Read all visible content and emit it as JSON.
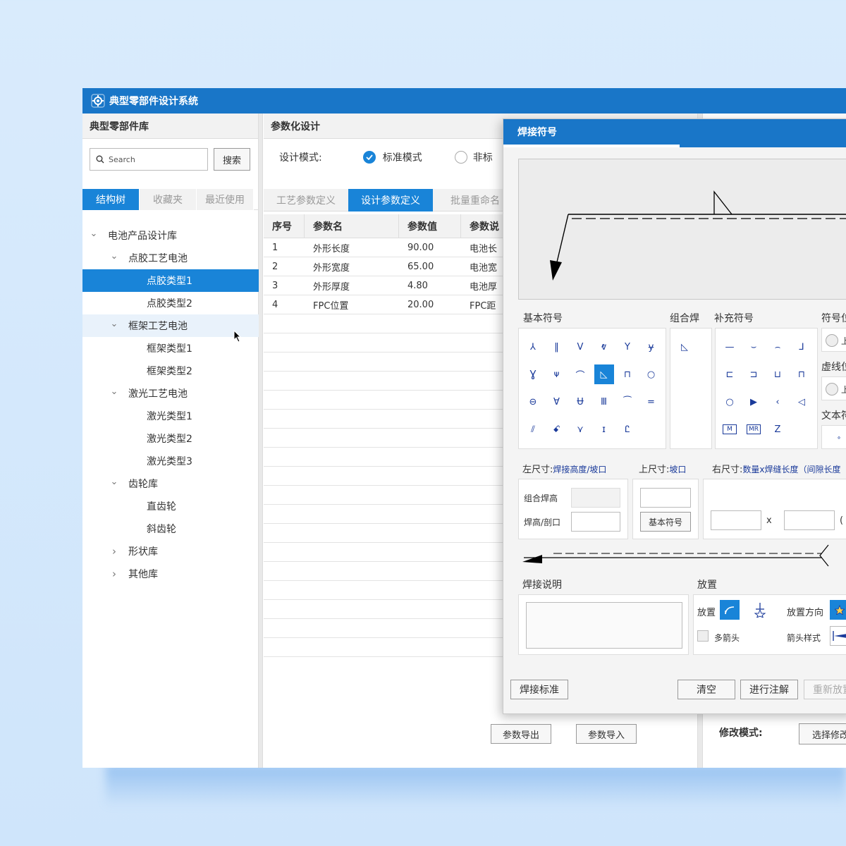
{
  "app": {
    "title": "典型零部件设计系统"
  },
  "left_panel": {
    "header": "典型零部件库",
    "search": {
      "placeholder": "Search",
      "button": "搜索"
    },
    "tabs": [
      "结构树",
      "收藏夹",
      "最近使用"
    ],
    "active_tab": "结构树",
    "tree": [
      {
        "label": "电池产品设计库",
        "level": 0,
        "expanded": true
      },
      {
        "label": "点胶工艺电池",
        "level": 1,
        "expanded": true
      },
      {
        "label": "点胶类型1",
        "level": 2,
        "selected": true
      },
      {
        "label": "点胶类型2",
        "level": 2
      },
      {
        "label": "框架工艺电池",
        "level": 1,
        "expanded": true,
        "hover": true
      },
      {
        "label": "框架类型1",
        "level": 2
      },
      {
        "label": "框架类型2",
        "level": 2
      },
      {
        "label": "激光工艺电池",
        "level": 1,
        "expanded": true
      },
      {
        "label": "激光类型1",
        "level": 2
      },
      {
        "label": "激光类型2",
        "level": 2
      },
      {
        "label": "激光类型3",
        "level": 2
      },
      {
        "label": "齿轮库",
        "level": 1,
        "expanded": true
      },
      {
        "label": "直齿轮",
        "level": 2
      },
      {
        "label": "斜齿轮",
        "level": 2
      },
      {
        "label": "形状库",
        "level": 1,
        "expanded": false
      },
      {
        "label": "其他库",
        "level": 1,
        "expanded": false
      }
    ]
  },
  "middle_panel": {
    "header": "参数化设计",
    "design_mode_label": "设计模式:",
    "mode_options": [
      "标准模式",
      "非标"
    ],
    "selected_mode": "标准模式",
    "tabs": [
      "工艺参数定义",
      "设计参数定义",
      "批量重命名"
    ],
    "active_tab": "设计参数定义",
    "table": {
      "columns": [
        "序号",
        "参数名",
        "参数值",
        "参数说"
      ],
      "rows": [
        [
          "1",
          "外形长度",
          "90.00",
          "电池长"
        ],
        [
          "2",
          "外形宽度",
          "65.00",
          "电池宽"
        ],
        [
          "3",
          "外形厚度",
          "4.80",
          "电池厚"
        ],
        [
          "4",
          "FPC位置",
          "20.00",
          "FPC距"
        ]
      ]
    },
    "export_button": "参数导出",
    "import_button": "参数导入"
  },
  "right_panel": {
    "modify_label": "修改模式:",
    "modify_button": "选择修改"
  },
  "dialog": {
    "title": "焊接符号",
    "basic_symbols_label": "基本符号",
    "combo_label": "组合焊",
    "supplement_label": "补充符号",
    "symbol_pos_label": "符号位",
    "dashed_label": "虚线位",
    "text_label": "文本符",
    "radio_up": "上",
    "left_size_label": "左尺寸:",
    "left_size_value": "焊接高度/坡口",
    "top_size_label": "上尺寸:",
    "top_size_value": "坡口",
    "right_size_label": "右尺寸:",
    "right_size_value": "数量x焊缝长度（间隙长度",
    "combo_height_label": "组合焊高",
    "weld_height_label": "焊高/剖口",
    "basic_symbol_button": "基本符号",
    "times_sign": "x",
    "paren": "(",
    "description_label": "焊接说明",
    "placement_label": "放置",
    "place_label": "放置",
    "place_direction_label": "放置方向",
    "multi_arrow_label": "多箭头",
    "arrow_style_label": "箭头样式",
    "standard_button": "焊接标准",
    "clear_button": "清空",
    "annotate_button": "进行注解",
    "replace_button": "重新放置",
    "basic_symbols": [
      "⅄",
      "‖",
      "V",
      "ⱴ",
      "Y",
      "ɏ",
      "Ɣ",
      "ᴪ",
      "⌒",
      "◺",
      "⊓",
      "○",
      "⊖",
      "Ɐ",
      "Ʉ",
      "Ⅲ",
      "⁀",
      "=",
      "⫽",
      "ꗃ",
      "⋎",
      "ɪ",
      "Ꮭ"
    ],
    "supplement_symbols": [
      "—",
      "⌣",
      "⌢",
      "⅃",
      "⊏",
      "⊐",
      "⊔",
      "⊓",
      "○",
      "▶",
      "‹",
      "◁",
      "M",
      "MR",
      "Z"
    ]
  },
  "colors": {
    "titlebar": "#1976c8",
    "accent": "#1984d8",
    "symbol": "#1a3a9a"
  }
}
